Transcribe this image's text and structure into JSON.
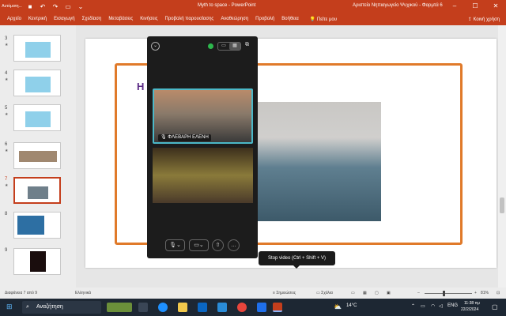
{
  "titlebar": {
    "autosave_label": "Αυτόματη...",
    "document_title": "Myth to space - PowerPoint",
    "user_label": "Αριστείο Νηπιαγωγείο Ψυχικού - Φαρμτά 6",
    "quick_access": [
      "save-icon",
      "undo-icon",
      "redo-icon",
      "present-icon"
    ]
  },
  "ribbon": {
    "tabs": [
      "Αρχείο",
      "Κεντρική",
      "Εισαγωγή",
      "Σχεδίαση",
      "Μεταβάσεις",
      "Κινήσεις",
      "Προβολή παρουσίασης",
      "Αναθεώρηση",
      "Προβολή",
      "Βοήθεια"
    ],
    "tell_me": "Πείτε μου",
    "share": "Κοινή χρήση"
  },
  "thumbnails": [
    {
      "number": "3",
      "starred": true
    },
    {
      "number": "4",
      "starred": true
    },
    {
      "number": "5",
      "starred": true
    },
    {
      "number": "6",
      "starred": true
    },
    {
      "number": "7",
      "starred": true,
      "selected": true
    },
    {
      "number": "8",
      "starred": false
    },
    {
      "number": "9",
      "starred": false
    }
  ],
  "slide": {
    "title_letter": "Η"
  },
  "meeting": {
    "participant_name": "ΦΛΕΒΑΡΗ ΕΛΕΝΗ",
    "view_modes": [
      "single-view-icon",
      "grid-view-icon"
    ],
    "controls": [
      "microphone-icon",
      "camera-icon",
      "share-icon",
      "more-icon"
    ]
  },
  "tooltip": {
    "text": "Stop video (Ctrl + Shift + V)"
  },
  "statusbar": {
    "slide_counter": "Διαφάνεια 7 από 9",
    "language": "Ελληνικά",
    "notes": "Σημειώσεις",
    "comments": "Σχόλια",
    "zoom": "81%"
  },
  "taskbar": {
    "search_placeholder": "Αναζήτηση",
    "temperature": "14°C",
    "keyboard_lang": "ENG",
    "time": "11:38 πμ",
    "date": "22/2/2024"
  },
  "colors": {
    "accent": "#c43e1c",
    "frame": "#e07a2a",
    "title_purple": "#5b2a86",
    "active_speaker": "#4bb8c8"
  }
}
